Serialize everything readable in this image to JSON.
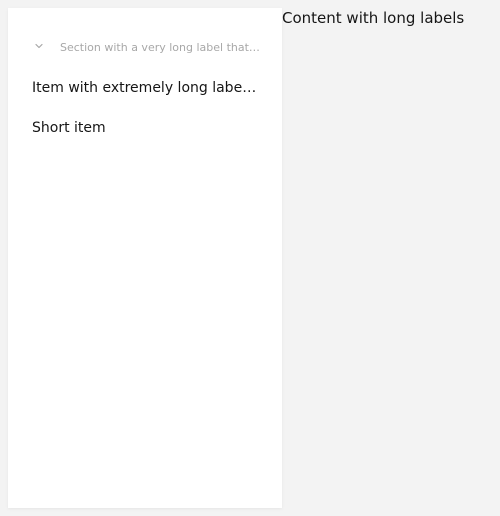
{
  "sidebar": {
    "section": {
      "label": "Section with a very long label that should be truncated",
      "icon": "chevron-down-icon"
    },
    "items": [
      {
        "label": "Item with extremely long label that will not fit"
      },
      {
        "label": "Short item"
      }
    ]
  },
  "main": {
    "title": "Content with long labels"
  },
  "colors": {
    "background": "#f3f3f3",
    "sidebar_bg": "#ffffff",
    "section_text": "#a8a8a8",
    "item_text": "#161616"
  }
}
